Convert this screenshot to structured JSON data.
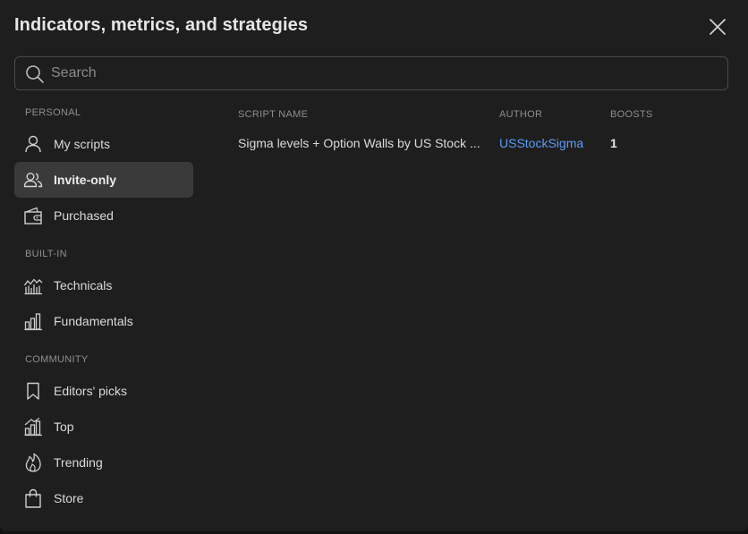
{
  "dialog": {
    "title": "Indicators, metrics, and strategies"
  },
  "search": {
    "placeholder": "Search",
    "value": ""
  },
  "sidebar": {
    "sections": [
      {
        "label": "PERSONAL",
        "items": [
          {
            "label": "My scripts",
            "icon": "user-icon",
            "active": false
          },
          {
            "label": "Invite-only",
            "icon": "users-icon",
            "active": true
          },
          {
            "label": "Purchased",
            "icon": "wallet-icon",
            "active": false
          }
        ]
      },
      {
        "label": "BUILT-IN",
        "items": [
          {
            "label": "Technicals",
            "icon": "technicals-icon",
            "active": false
          },
          {
            "label": "Fundamentals",
            "icon": "bar-chart-icon",
            "active": false
          }
        ]
      },
      {
        "label": "COMMUNITY",
        "items": [
          {
            "label": "Editors' picks",
            "icon": "bookmark-icon",
            "active": false
          },
          {
            "label": "Top",
            "icon": "top-chart-icon",
            "active": false
          },
          {
            "label": "Trending",
            "icon": "flame-icon",
            "active": false
          },
          {
            "label": "Store",
            "icon": "shopping-bag-icon",
            "active": false
          }
        ]
      }
    ]
  },
  "table": {
    "headers": {
      "script_name": "SCRIPT NAME",
      "author": "AUTHOR",
      "boosts": "BOOSTS"
    },
    "rows": [
      {
        "script_name": "Sigma levels + Option Walls by US Stock ...",
        "author": "USStockSigma",
        "boosts": "1"
      }
    ]
  },
  "colors": {
    "background": "#1e1e1e",
    "active_item": "#3a3a3a",
    "link": "#5b9cf6",
    "muted_text": "#8f8f8f"
  }
}
